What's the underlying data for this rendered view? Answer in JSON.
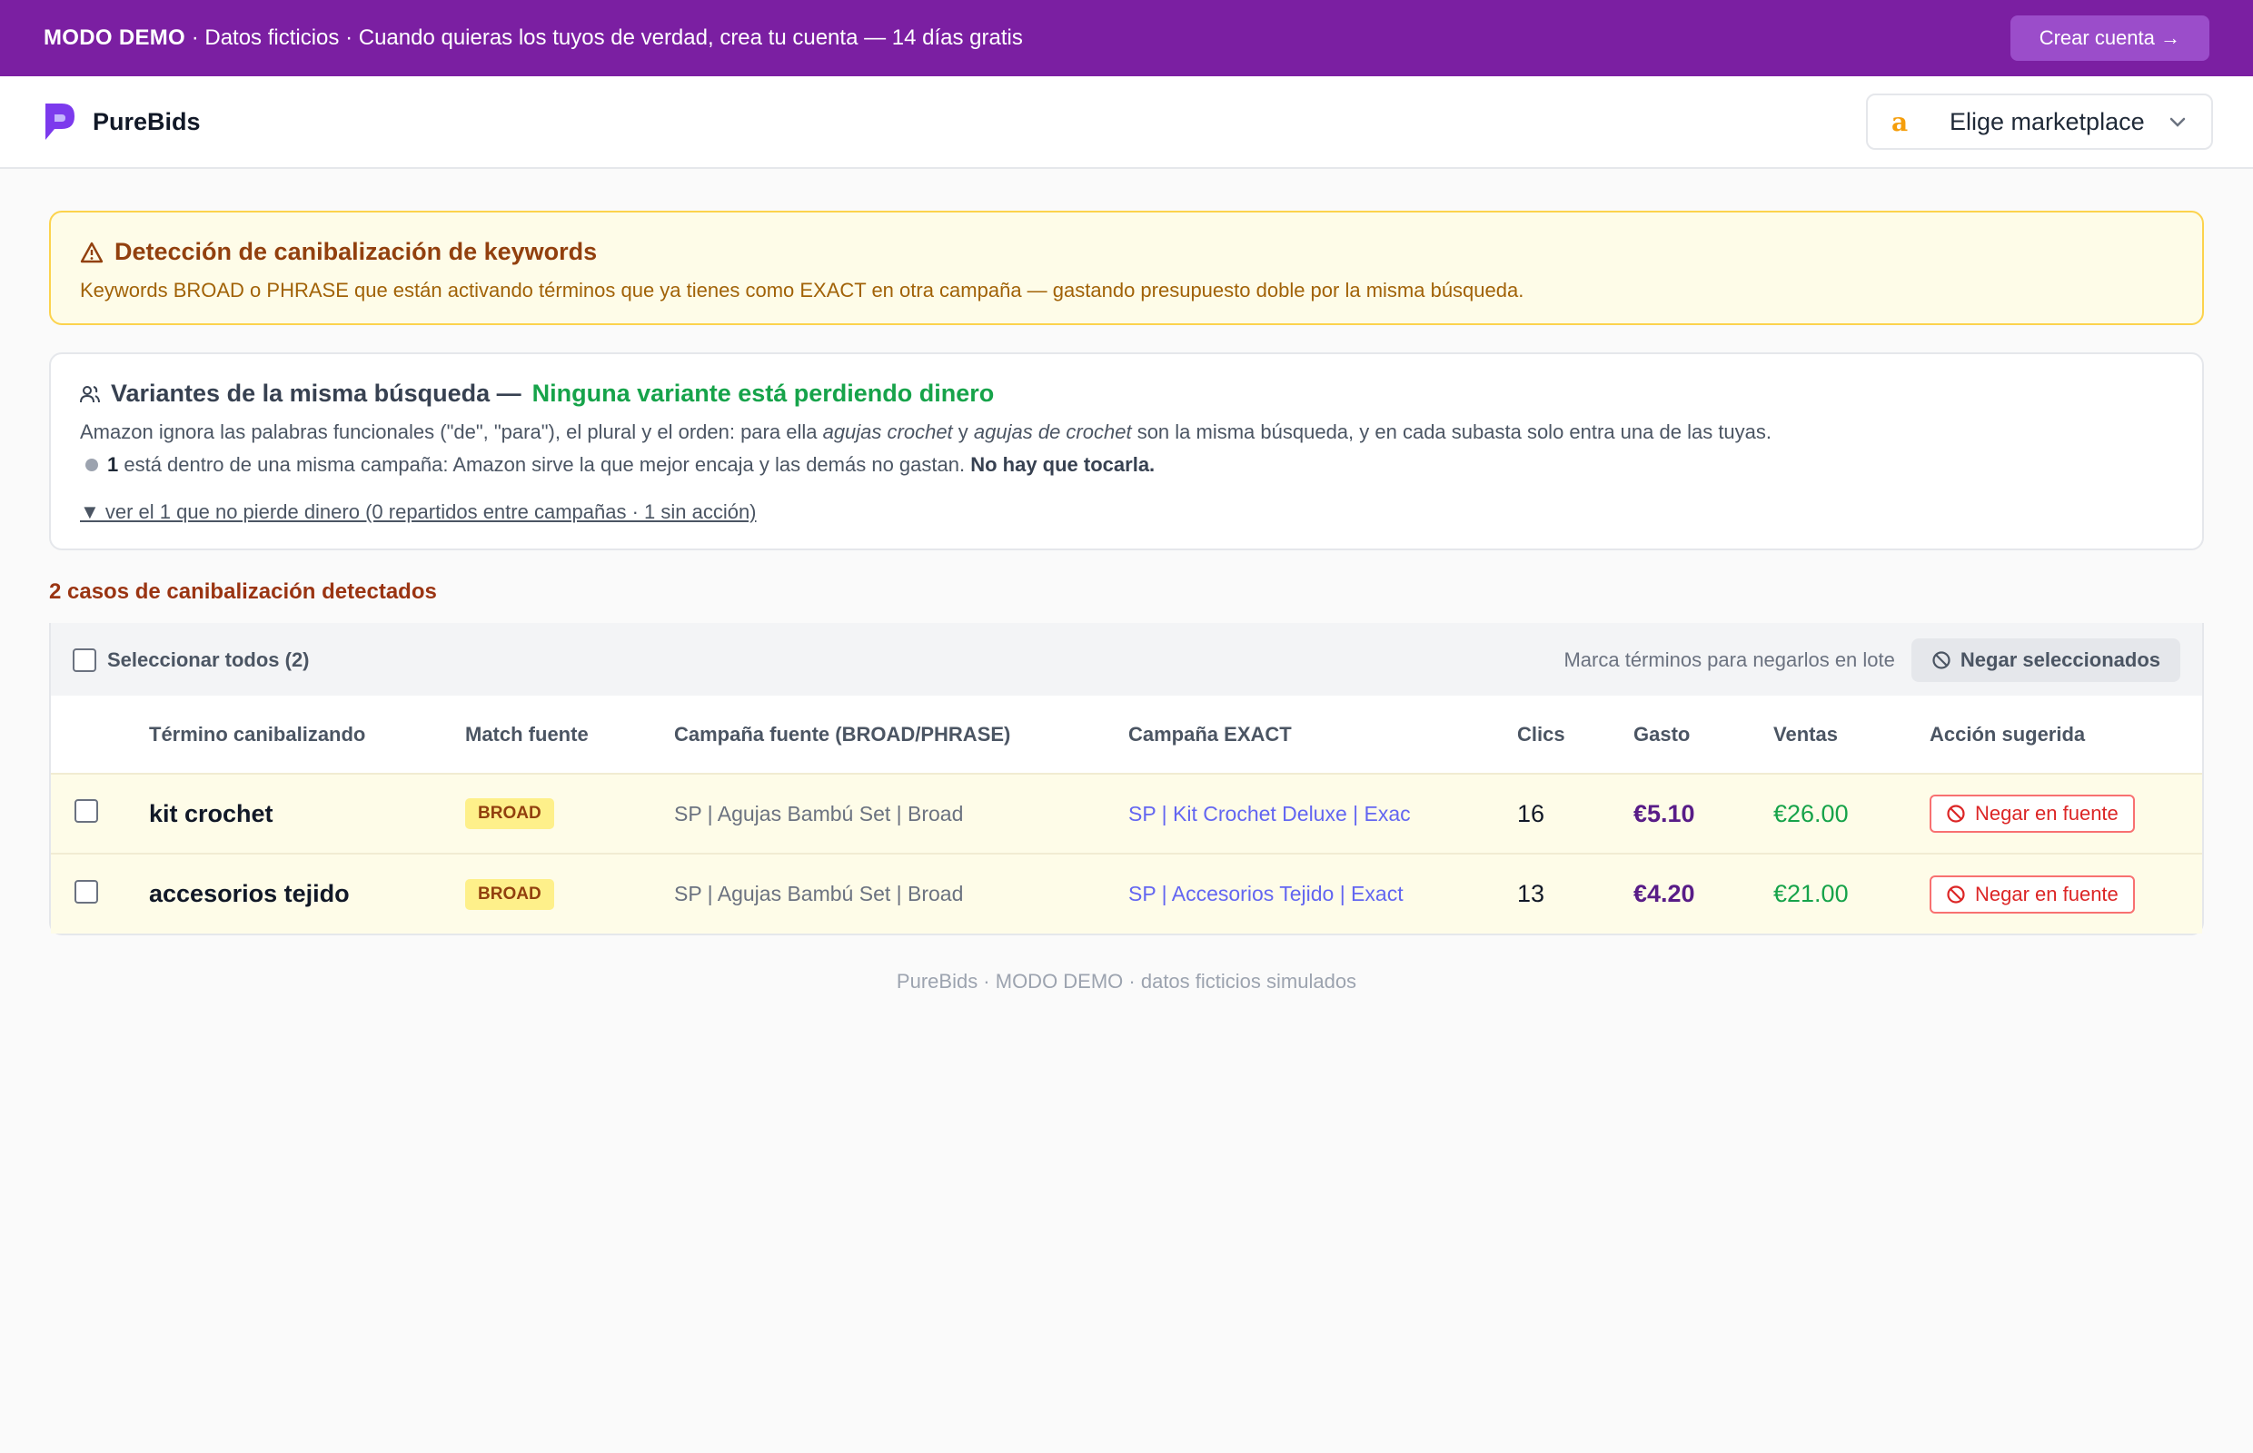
{
  "banner": {
    "mode": "MODO DEMO",
    "message": " · Datos ficticios · Cuando quieras los tuyos de verdad, crea tu cuenta — 14 días gratis",
    "cta": "Crear cuenta →"
  },
  "header": {
    "brand": "PureBids",
    "marketplace_label": "Elige marketplace"
  },
  "warning": {
    "title": "Detección de canibalización de keywords",
    "description": "Keywords BROAD o PHRASE que están activando términos que ya tienes como EXACT en otra campaña — gastando presupuesto doble por la misma búsqueda."
  },
  "variants": {
    "title": "Variantes de la misma búsqueda —",
    "status": "Ninguna variante está perdiendo dinero",
    "desc_before": "Amazon ignora las palabras funcionales (\"de\", \"para\"), el plural y el orden: para ella ",
    "example1": "agujas crochet",
    "desc_middle": " y ",
    "example2": "agujas de crochet",
    "desc_after": " son la misma búsqueda, y en cada subasta solo entra una de las tuyas.",
    "point_count": "1",
    "point_text": " está dentro de una misma campaña: Amazon sirve la que mejor encaja y las demás no gastan. ",
    "point_strong": "No hay que tocarla.",
    "toggle": "▼ ver el 1 que no pierde dinero (0 repartidos entre campañas · 1 sin acción)"
  },
  "cases_label": "2 casos de canibalización detectados",
  "toolbar": {
    "select_all": "Seleccionar todos (2)",
    "hint": "Marca términos para negarlos en lote",
    "negate_batch": "Negar seleccionados"
  },
  "table": {
    "headers": {
      "term": "Término canibalizando",
      "match": "Match fuente",
      "source": "Campaña fuente (BROAD/PHRASE)",
      "exact": "Campaña EXACT",
      "clicks": "Clics",
      "spend": "Gasto",
      "sales": "Ventas",
      "action": "Acción sugerida"
    },
    "rows": [
      {
        "term": "kit crochet",
        "match": "BROAD",
        "source": "SP | Agujas Bambú Set | Broad",
        "exact": "SP | Kit Crochet Deluxe | Exac",
        "clicks": "16",
        "spend": "€5.10",
        "sales": "€26.00",
        "action": "Negar en fuente"
      },
      {
        "term": "accesorios tejido",
        "match": "BROAD",
        "source": "SP | Agujas Bambú Set | Broad",
        "exact": "SP | Accesorios Tejido | Exact",
        "clicks": "13",
        "spend": "€4.20",
        "sales": "€21.00",
        "action": "Negar en fuente"
      }
    ]
  },
  "footer": "PureBids · MODO DEMO · datos ficticios simulados",
  "colors": {
    "banner": "#7b1fa2",
    "warning_bg": "#fefce8",
    "ok_green": "#16a34a",
    "spend_purple": "#581c87",
    "danger": "#dc2626"
  }
}
